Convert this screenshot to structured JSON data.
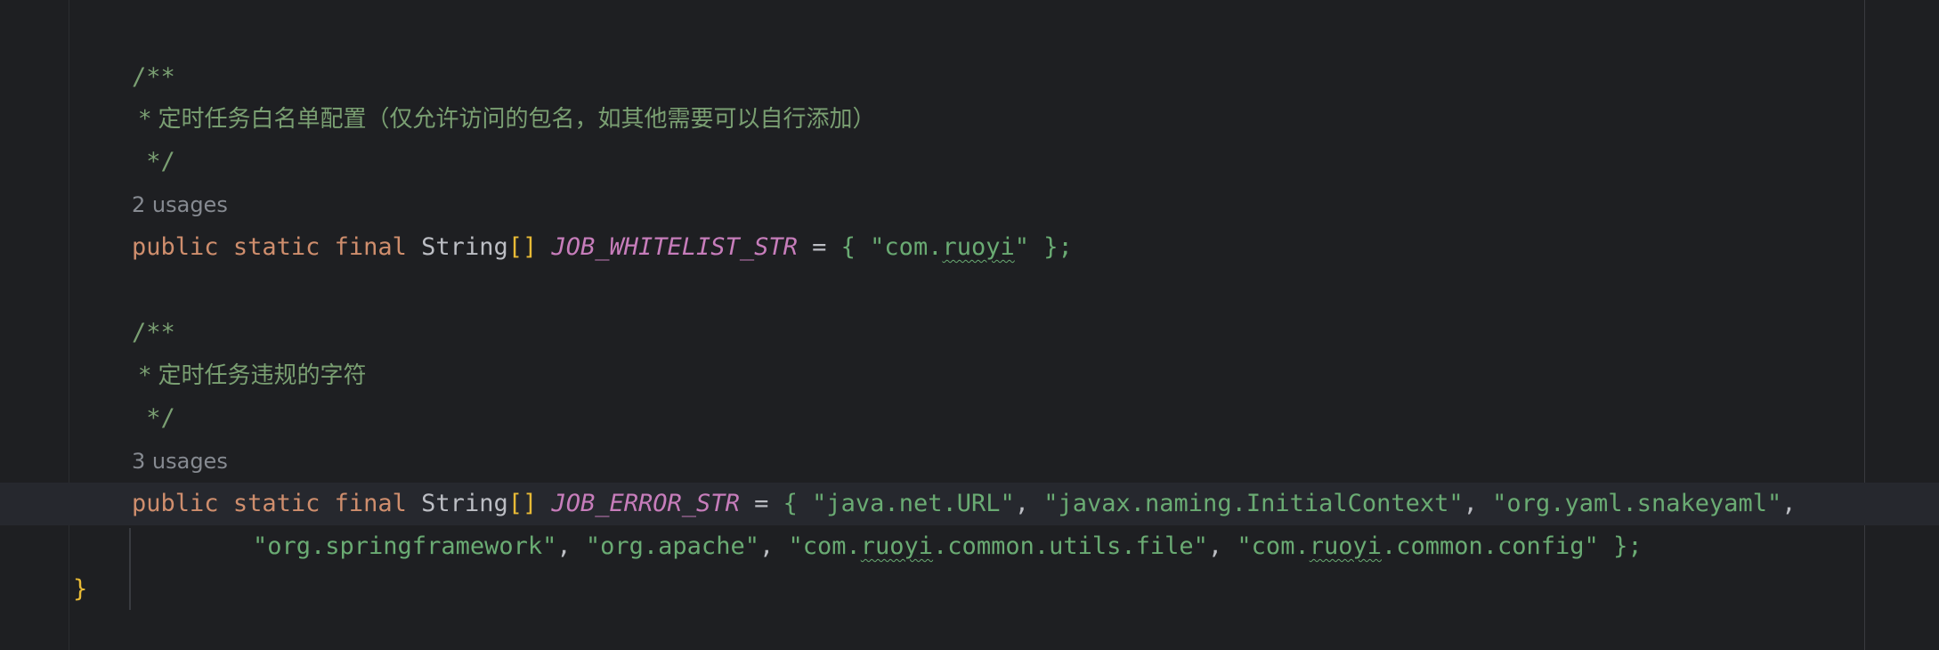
{
  "editor": {
    "comment1": {
      "open": "/**",
      "body": " * 定时任务白名单配置（仅允许访问的包名，如其他需要可以自行添加）",
      "close": " */"
    },
    "usages1": "2 usages",
    "decl1": {
      "public": "public",
      "static": "static",
      "final": "final",
      "type": "String",
      "brackets": "[]",
      "name": "JOB_WHITELIST_STR",
      "eq": "=",
      "open_brace": "{",
      "s1_pre": "\"com.",
      "s1_typo": "ruoyi",
      "s1_post": "\"",
      "close": "};"
    },
    "comment2": {
      "open": "/**",
      "body": " * 定时任务违规的字符",
      "close": " */"
    },
    "usages2": "3 usages",
    "decl2": {
      "public": "public",
      "static": "static",
      "final": "final",
      "type": "String",
      "brackets": "[]",
      "name": "JOB_ERROR_STR",
      "eq": "=",
      "open_brace": "{",
      "s1": "\"java.net.URL\"",
      "s2": "\"javax.naming.InitialContext\"",
      "s3": "\"org.yaml.snakeyaml\"",
      "s4": "\"org.springframework\"",
      "s5": "\"org.apache\"",
      "s6_pre": "\"com.",
      "s6_typo": "ruoyi",
      "s6_post": ".common.utils.file\"",
      "s7_pre": "\"com.",
      "s7_typo": "ruoyi",
      "s7_post": ".common.config\"",
      "close": "};"
    },
    "class_close": "}"
  },
  "colors": {
    "background": "#1e1f22",
    "keyword": "#cf8e6d",
    "string": "#6aab73",
    "field": "#c77dbb",
    "comment": "#7a9f72",
    "bracket": "#e8ba36"
  }
}
